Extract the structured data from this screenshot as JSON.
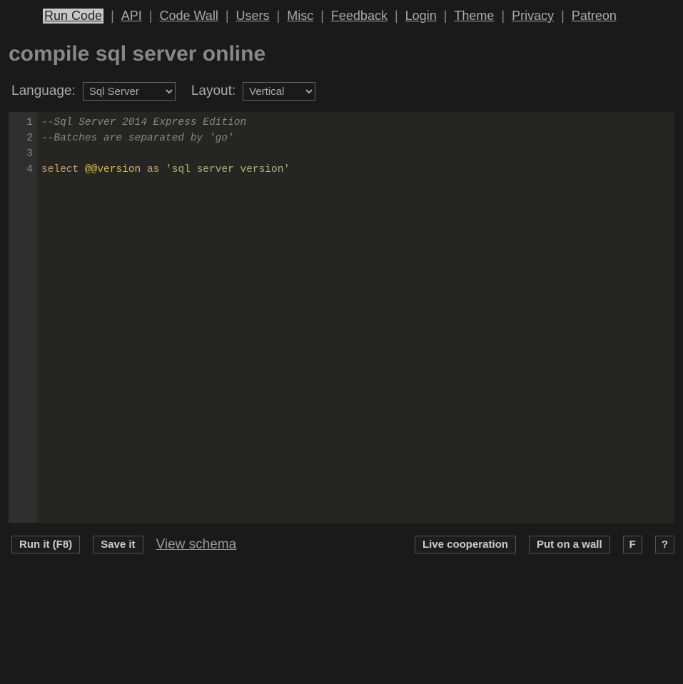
{
  "nav": {
    "items": [
      {
        "label": "Run Code",
        "active": true
      },
      {
        "label": "API"
      },
      {
        "label": "Code Wall"
      },
      {
        "label": "Users"
      },
      {
        "label": "Misc"
      },
      {
        "label": "Feedback"
      },
      {
        "label": "Login"
      },
      {
        "label": "Theme"
      },
      {
        "label": "Privacy"
      },
      {
        "label": "Patreon"
      }
    ],
    "separator": "|"
  },
  "page": {
    "title": "compile sql server online"
  },
  "controls": {
    "language_label": "Language:",
    "language_value": "Sql Server",
    "layout_label": "Layout:",
    "layout_value": "Vertical"
  },
  "editor": {
    "line_numbers": [
      "1",
      "2",
      "3",
      "4"
    ],
    "lines": [
      {
        "type": "comment",
        "text": "--Sql Server 2014 Express Edition"
      },
      {
        "type": "comment",
        "text": "--Batches are separated by 'go'"
      },
      {
        "type": "blank",
        "text": ""
      },
      {
        "type": "code",
        "tokens": [
          {
            "cls": "keyword",
            "t": "select"
          },
          {
            "cls": "plain",
            "t": " "
          },
          {
            "cls": "sysvar",
            "t": "@@version"
          },
          {
            "cls": "plain",
            "t": " "
          },
          {
            "cls": "keyword",
            "t": "as"
          },
          {
            "cls": "plain",
            "t": " "
          },
          {
            "cls": "string",
            "t": "'sql server version'"
          }
        ]
      }
    ]
  },
  "bottom": {
    "run": "Run it (F8)",
    "save": "Save it",
    "view_schema": "View schema",
    "live_coop": "Live cooperation",
    "put_wall": "Put on a wall",
    "fullscreen": "F",
    "help": "?"
  }
}
